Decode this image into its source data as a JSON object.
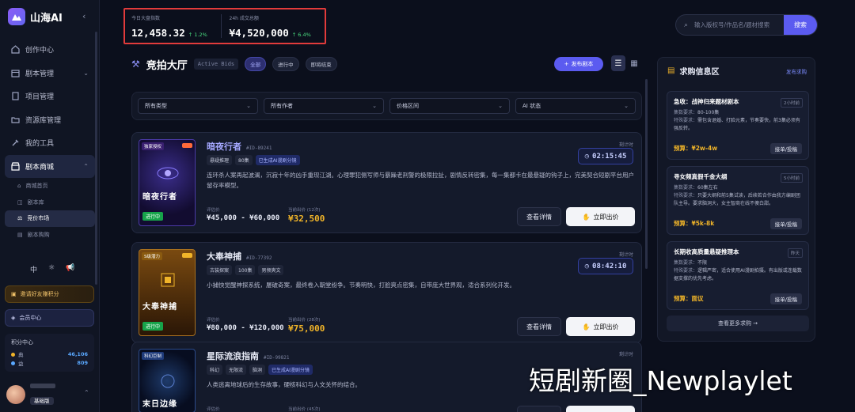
{
  "brand": {
    "name": "山海AI"
  },
  "nav": {
    "items": [
      {
        "label": "创作中心",
        "icon": "home-icon"
      },
      {
        "label": "剧本管理",
        "icon": "calendar-icon"
      },
      {
        "label": "项目管理",
        "icon": "file-icon"
      },
      {
        "label": "资源库管理",
        "icon": "folder-icon"
      },
      {
        "label": "我的工具",
        "icon": "tools-icon"
      },
      {
        "label": "剧本商城",
        "icon": "store-icon"
      }
    ],
    "subitems": [
      {
        "label": "商城首页"
      },
      {
        "label": "剧本库"
      },
      {
        "label": "竞价市场"
      },
      {
        "label": "剧本购购"
      }
    ],
    "tools": [
      "中",
      "☼",
      "📢"
    ],
    "invite": "邀请好友赚积分",
    "vip": "会员中心",
    "points": {
      "title": "积分中心",
      "rows": [
        {
          "label": "典",
          "value": "46,106",
          "color": "#f0b429"
        },
        {
          "label": "益",
          "value": "809",
          "color": "#5aa8ff"
        }
      ]
    },
    "user": {
      "plan": "基础版"
    }
  },
  "stats": [
    {
      "label": "今日大盘指数",
      "value": "12,458.32",
      "change": "↑ 1.2%"
    },
    {
      "label": "24h 成交总额",
      "value": "¥4,520,000",
      "change": "↑ 6.4%"
    }
  ],
  "search": {
    "placeholder": "输入版权号/作品名/题材搜索",
    "button": "搜索"
  },
  "hall": {
    "title": "竞拍大厅",
    "subtitle": "Active Bids",
    "chips": [
      "全部",
      "进行中",
      "即将结束"
    ],
    "publish": "发布剧本"
  },
  "filters": [
    "所有类型",
    "所有作者",
    "价格区间",
    "AI 状态"
  ],
  "labels": {
    "countdown": "剩计时",
    "range": "评估价",
    "current": "当前出价",
    "detail": "查看详情",
    "bid": "立即出价"
  },
  "cards": [
    {
      "title": "暗夜行者",
      "id": "#ID-89241",
      "tags": [
        "悬疑推理",
        "80集",
        "已生成AI漫剧分镜"
      ],
      "desc": "连环杀人案再起波澜，沉寂十年的凶手重现江湖。心理罪犯侧写师与暴躁老刑警的极限拉扯，剧情反转密集，每一集都卡在最悬疑的钩子上，完美契合短剧平台用户留存率模型。",
      "countdown": "02:15:45",
      "range": "¥45,000 - ¥60,000",
      "current_label": "当前出价 (12次)",
      "current": "¥32,500",
      "poster": {
        "tag": "独家授权",
        "name": "暗夜行者",
        "live": "进行中"
      }
    },
    {
      "title": "大奉神捕",
      "id": "#ID-77392",
      "tags": [
        "古装探案",
        "100集",
        "男频爽文"
      ],
      "desc": "小捕快觉醒神探系统，屡破奇案，最终卷入朝堂纷争。节奏明快，打脸爽点密集，自带庞大世界观，适合系列化开发。",
      "countdown": "08:42:10",
      "range": "¥80,000 - ¥120,000",
      "current_label": "当前出价 (28次)",
      "current": "¥75,000",
      "poster": {
        "tag": "S级潜力",
        "name": "大奉神捕",
        "live": "进行中"
      }
    },
    {
      "title": "星际流浪指南",
      "id": "#ID-99821",
      "tags": [
        "科幻",
        "无限流",
        "脑洞",
        "已生成AI漫剧分镜"
      ],
      "desc": "人类逃离地球后的生存故事，硬核科幻与人文关怀的结合。",
      "countdown": "",
      "range": "",
      "current_label": "当前出价 (45次)",
      "current": "",
      "poster": {
        "tag": "科幻巨制",
        "name": "末日边缘",
        "live": ""
      }
    }
  ],
  "panel": {
    "title": "求购信息区",
    "link": "发布求购",
    "requests": [
      {
        "title": "急收：战神归来题材剧本",
        "time": "2小时前",
        "count_label": "集数要求：",
        "count": "80-100集",
        "req_label": "特殊要求：",
        "req": "需包含退婚、打脸元素，节奏要快，前3集必须有强反转。",
        "budget": "预算：¥2w-4w",
        "take": "接单/投稿"
      },
      {
        "title": "寻女频真假千金大纲",
        "time": "5小时前",
        "count_label": "集数要求：",
        "count": "60集左右",
        "req_label": "特殊要求：",
        "req": "只要大纲和前5集试读，后续若合作由我方编剧团队主导。要求脑洞大，女主智商在线不傻白甜。",
        "budget": "预算：¥5k-8k",
        "take": "接单/投稿"
      },
      {
        "title": "长期收高质量悬疑推理本",
        "time": "昨天",
        "count_label": "集数要求：",
        "count": "不限",
        "req_label": "特殊要求：",
        "req": "逻辑严密，适合使用AI漫剧拍摄。有出版或连载数据支撑的优先考虑。",
        "budget": "预算：面议",
        "take": "接单/投稿"
      }
    ],
    "more": "查看更多求购 →"
  },
  "watermark": "短剧新圈_Newplaylet"
}
